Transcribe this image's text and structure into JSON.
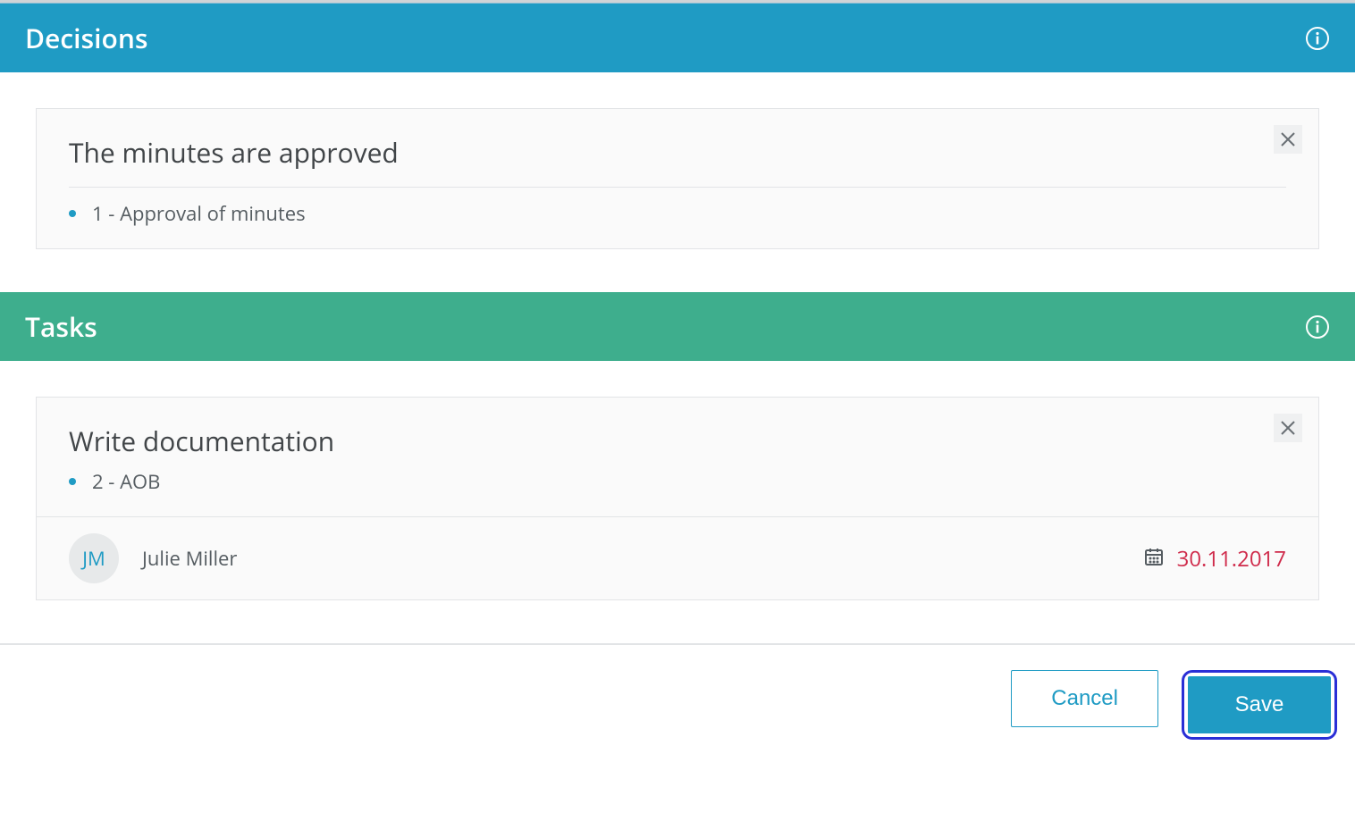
{
  "sections": {
    "decisions": {
      "title": "Decisions"
    },
    "tasks": {
      "title": "Tasks"
    }
  },
  "decisions": {
    "card": {
      "title": "The minutes are approved",
      "item": "1 - Approval of minutes"
    }
  },
  "tasks": {
    "card": {
      "title": "Write documentation",
      "item": "2 - AOB",
      "assignee": {
        "initials": "JM",
        "name": "Julie Miller"
      },
      "due": "30.11.2017"
    }
  },
  "footer": {
    "cancel": "Cancel",
    "save": "Save"
  },
  "colors": {
    "decisions_header": "#1f9bc4",
    "tasks_header": "#3eae8d",
    "due_date": "#cf2a4a",
    "highlight_ring": "#2a2fd6"
  }
}
